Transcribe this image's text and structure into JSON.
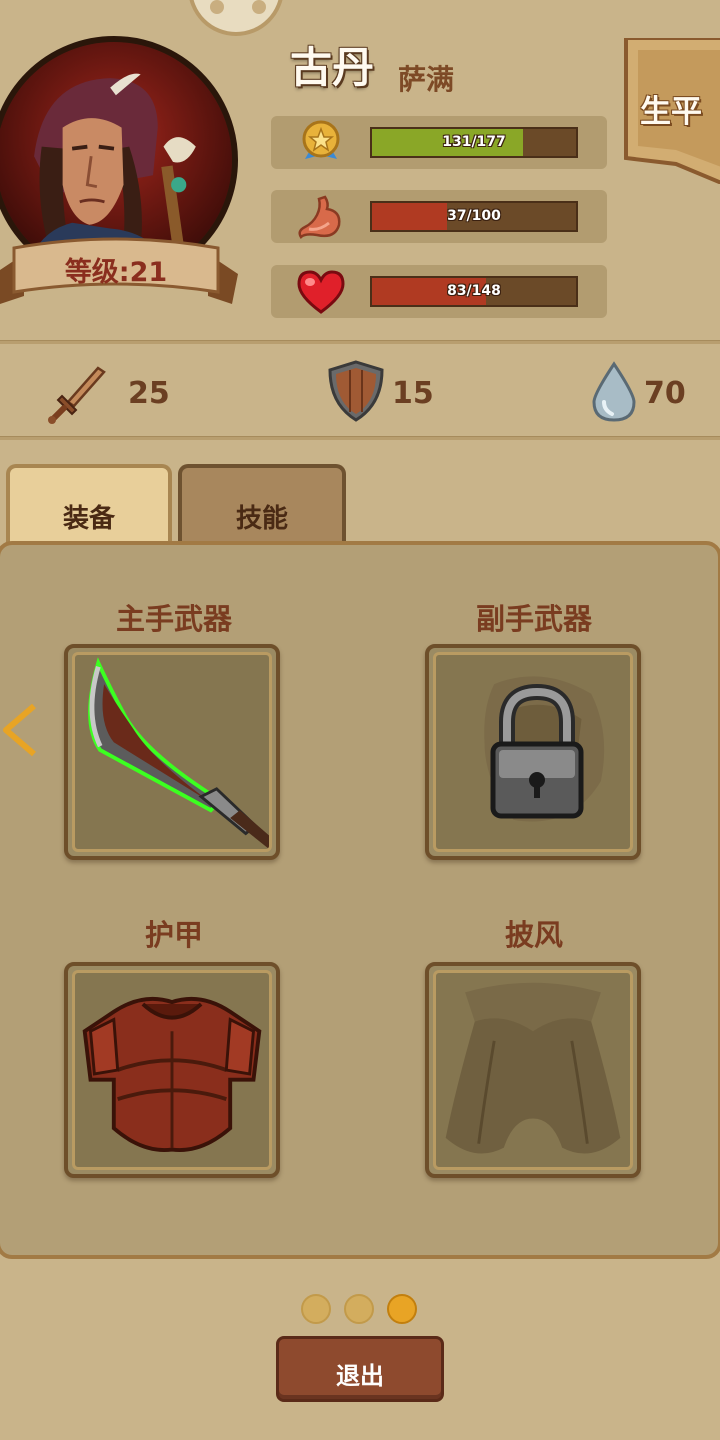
{
  "character": {
    "name": "古丹",
    "class": "萨满",
    "level_label": "等级:21",
    "biography_button": "生平"
  },
  "stats": [
    {
      "name": "experience",
      "icon": "medal-icon",
      "current": 131,
      "max": 177,
      "text": "131/177",
      "color": "#8aa727"
    },
    {
      "name": "hunger",
      "icon": "stomach-icon",
      "current": 37,
      "max": 100,
      "text": "37/100",
      "color": "#b03a22"
    },
    {
      "name": "health",
      "icon": "heart-icon",
      "current": 83,
      "max": 148,
      "text": "83/148",
      "color": "#b03a22"
    }
  ],
  "attributes": [
    {
      "icon": "sword-icon",
      "value": "25"
    },
    {
      "icon": "shield-icon",
      "value": "15"
    },
    {
      "icon": "water-drop-icon",
      "value": "70"
    }
  ],
  "tabs": [
    {
      "label": "装备",
      "active": true
    },
    {
      "label": "技能",
      "active": false
    }
  ],
  "slots": [
    {
      "label": "主手武器",
      "state": "equipped",
      "icon": "curved-blade-icon"
    },
    {
      "label": "副手武器",
      "state": "locked",
      "icon": "padlock-icon"
    },
    {
      "label": "护甲",
      "state": "equipped",
      "icon": "leather-armor-icon"
    },
    {
      "label": "披风",
      "state": "empty",
      "icon": "cloak-silhouette-icon"
    }
  ],
  "pagination": {
    "pages": 3,
    "current": 3
  },
  "exit_button": "退出",
  "colors": {
    "background": "#c9b48a",
    "panel": "#b39f76",
    "accent_text": "#7a3c20",
    "exit_button": "#8e4a2e"
  }
}
